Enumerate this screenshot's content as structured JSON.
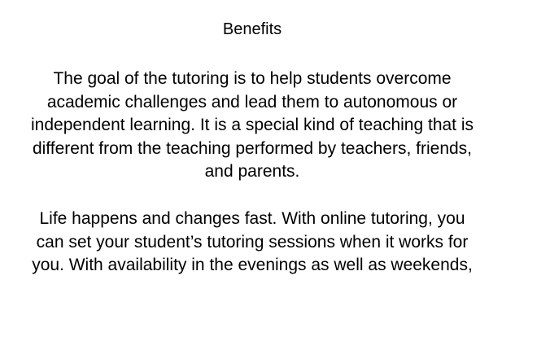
{
  "document": {
    "heading": "Benefits",
    "paragraphs": [
      "The goal of the tutoring is to help students overcome academic challenges and lead them to autonomous or independent learning. It is a special kind of teaching that is different from the teaching performed by teachers, friends, and parents.",
      "Life happens and changes fast. With online tutoring, you can set your student’s tutoring sessions when it works for you. With availability in the evenings as well as weekends,"
    ]
  }
}
